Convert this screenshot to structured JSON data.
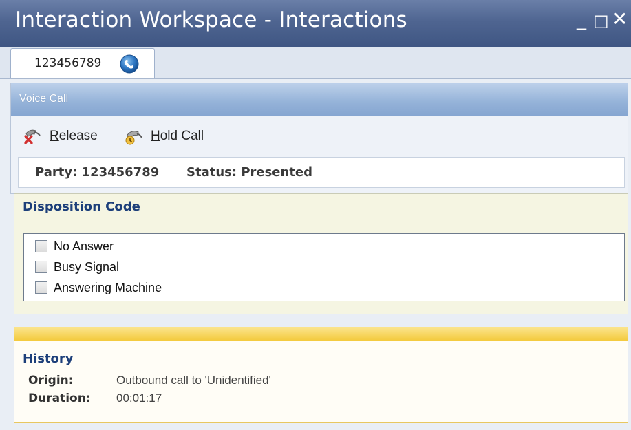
{
  "window": {
    "title": "Interaction Workspace - Interactions",
    "controls": {
      "minimize": "_",
      "maximize": "□",
      "close": "✕"
    }
  },
  "tabs": [
    {
      "label": "123456789",
      "icon": "phone-call-icon"
    }
  ],
  "voice_call": {
    "header": "Voice Call",
    "toolbar": {
      "release": {
        "accel": "R",
        "rest": "elease",
        "icon": "release-call-icon"
      },
      "hold": {
        "accel": "H",
        "rest": "old Call",
        "icon": "hold-call-icon"
      }
    },
    "status": {
      "party": "Party: 123456789",
      "status": "Status: Presented"
    }
  },
  "disposition": {
    "header": "Disposition Code",
    "options": [
      {
        "label": "No Answer",
        "checked": false
      },
      {
        "label": "Busy Signal",
        "checked": false
      },
      {
        "label": "Answering Machine",
        "checked": false
      }
    ]
  },
  "history": {
    "header": "History",
    "rows": [
      {
        "key": "Origin:",
        "value": "Outbound call to 'Unidentified'"
      },
      {
        "key": "Duration:",
        "value": "00:01:17"
      }
    ]
  },
  "colors": {
    "titlebar": "#4f6591",
    "section_header": "#94b2d8",
    "heading_text": "#1d3f7a",
    "history_bar": "#f3c93a"
  }
}
